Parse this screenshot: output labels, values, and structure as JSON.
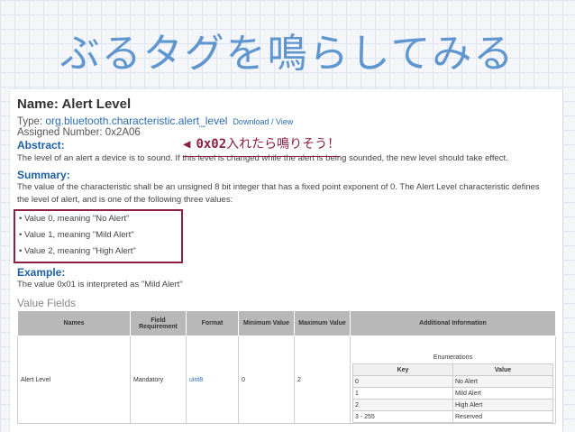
{
  "slide": {
    "title": "ぶるタグを鳴らしてみる"
  },
  "doc": {
    "name": "Name: Alert Level",
    "type_label": "Type: ",
    "type_value": "org.bluetooth.characteristic.alert_level",
    "type_link": "Download / View",
    "assigned": "Assigned Number: 0x2A06",
    "abstract_head": "Abstract:",
    "abstract_text": "The level of an alert a device is to sound. If this level is changed while the alert is being sounded, the new level should take effect.",
    "summary_head": "Summary:",
    "summary_text": "The value of the characteristic shall be an unsigned 8 bit integer that has a fixed point exponent of 0. The Alert Level characteristic defines the level of alert, and is one of the following three values:",
    "bullets": [
      "• Value 0, meaning \"No Alert\"",
      "• Value 1, meaning \"Mild Alert\"",
      "• Value 2, meaning \"High Alert\""
    ],
    "example_head": "Example:",
    "example_text": "The value 0x01 is interpreted as \"Mild Alert\"",
    "value_fields_head": "Value Fields"
  },
  "callout": {
    "arrow": "◀",
    "code": "0x02",
    "text": "入れたら鳴りそう！"
  },
  "table": {
    "headers": [
      "Names",
      "Field Requirement",
      "Format",
      "Minimum Value",
      "Maximum Value",
      "Additional Information"
    ],
    "row": {
      "name": "Alert Level",
      "requirement": "Mandatory",
      "format": "uint8",
      "min": "0",
      "max": "2"
    },
    "enum_title": "Enumerations",
    "enum_headers": [
      "Key",
      "Value"
    ],
    "enum_rows": [
      {
        "key": "0",
        "value": "No Alert"
      },
      {
        "key": "1",
        "value": "Mild Alert"
      },
      {
        "key": "2",
        "value": "High Alert"
      },
      {
        "key": "3 - 255",
        "value": "Reserved"
      }
    ]
  },
  "colors": {
    "title": "#5f96d0",
    "highlight": "#8b1f45",
    "link": "#2b6cb0",
    "heading": "#1d5fa3"
  }
}
